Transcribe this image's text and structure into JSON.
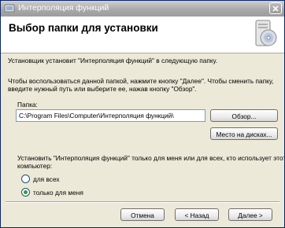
{
  "window": {
    "title": "Интерполяция функций",
    "icon": "installer-icon",
    "close_icon": "close-icon"
  },
  "header": {
    "title": "Выбор папки для установки",
    "icon": "computer-cd-icon"
  },
  "body": {
    "line1": "Установщик установит \"Интерполяция функций\" в следующую папку.",
    "line2": "Чтобы воспользоваться данной папкой, нажмите кнопку \"Далее\". Чтобы сменить папку,",
    "line3": "введите нужный путь или выберите ее, нажав кнопку \"Обзор\"."
  },
  "folder": {
    "label": "Папка:",
    "value": "C:\\Program Files\\Computer\\Интерполяция функций\\",
    "browse_label": "Обзор...",
    "disk_space_label": "Место на дисках..."
  },
  "install_for": {
    "question_line1": "Установить \"Интерполяция функций\" только для меня или для всех, кто использует этот",
    "question_line2": "компьютер:",
    "options": [
      {
        "label": "для всех",
        "checked": false
      },
      {
        "label": "только для меня",
        "checked": true
      }
    ]
  },
  "footer": {
    "cancel_label": "Отмена",
    "back_label": "< Назад",
    "next_label": "Далее >"
  }
}
